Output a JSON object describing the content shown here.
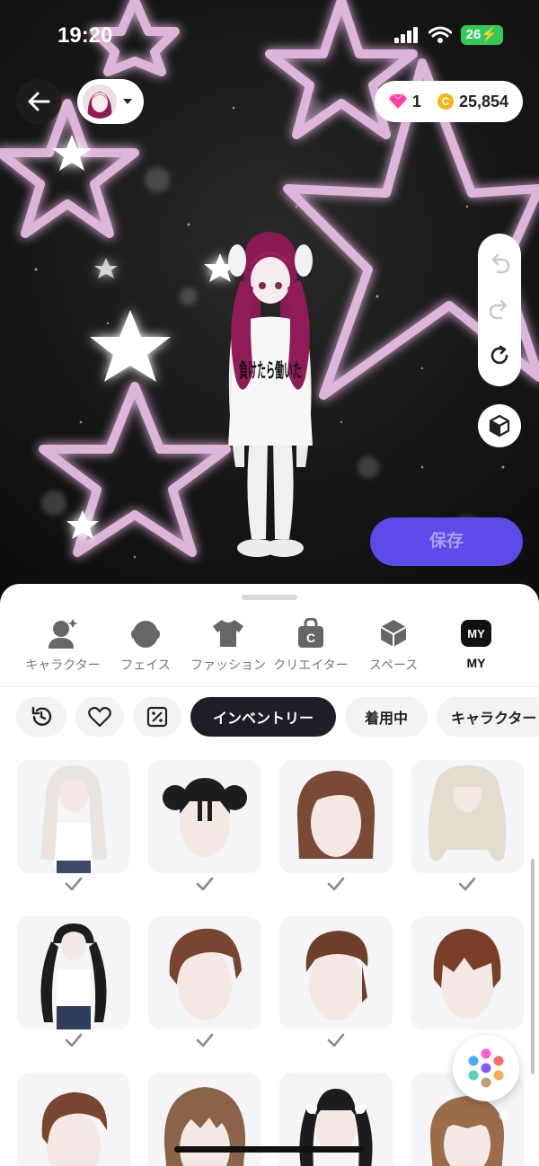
{
  "status": {
    "time": "19:20",
    "battery": "26"
  },
  "currency": {
    "gems": "1",
    "coins": "25,854",
    "coin_glyph": "C"
  },
  "character_shirt_text": "負けたら働いた",
  "save_label": "保存",
  "categories": [
    {
      "label": "キャラクター",
      "icon": "character-icon"
    },
    {
      "label": "フェイス",
      "icon": "face-icon"
    },
    {
      "label": "ファッション",
      "icon": "shirt-icon"
    },
    {
      "label": "クリエイター",
      "icon": "creator-bag-icon",
      "glyph": "C"
    },
    {
      "label": "スペース",
      "icon": "space-cube-icon"
    },
    {
      "label": "MY",
      "icon": "my-icon",
      "glyph": "MY",
      "active": true
    }
  ],
  "filters": {
    "history_icon": "history-icon",
    "favorite_icon": "heart-icon",
    "coupon_icon": "discount-icon",
    "chips": [
      "インベントリー",
      "着用中",
      "キャラクター"
    ]
  },
  "items": [
    {
      "hair": "long-white",
      "checked": true
    },
    {
      "hair": "black-buns",
      "checked": true
    },
    {
      "hair": "brown-bob",
      "checked": true
    },
    {
      "hair": "cream-wavy",
      "checked": true
    },
    {
      "hair": "black-twintails",
      "checked": true
    },
    {
      "hair": "brown-quiff",
      "checked": true
    },
    {
      "hair": "brown-undercut",
      "checked": true
    },
    {
      "hair": "brown-bowl",
      "checked": false
    },
    {
      "hair": "brown-sidepart",
      "checked": false
    },
    {
      "hair": "brown-fluffy",
      "checked": false
    },
    {
      "hair": "black-pigtails",
      "checked": false
    },
    {
      "hair": "brown-tied",
      "checked": false
    }
  ],
  "colors": {
    "accent": "#5b4be8",
    "dark_chip": "#1e1e28",
    "star_glow": "#f3c6f0",
    "battery": "#34c759"
  }
}
